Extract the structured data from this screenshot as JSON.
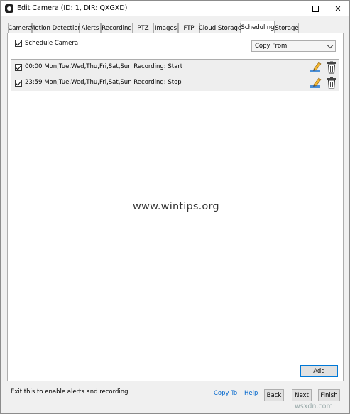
{
  "window": {
    "title": "Edit Camera (ID: 1, DIR: QXGXD)"
  },
  "tabs": [
    {
      "label": "Camera"
    },
    {
      "label": "Motion Detection"
    },
    {
      "label": "Alerts"
    },
    {
      "label": "Recording"
    },
    {
      "label": "PTZ"
    },
    {
      "label": "Images"
    },
    {
      "label": "FTP"
    },
    {
      "label": "Cloud Storage"
    },
    {
      "label": "Scheduling",
      "active": true
    },
    {
      "label": "Storage"
    }
  ],
  "scheduling": {
    "schedule_camera_label": "Schedule Camera",
    "schedule_camera_checked": true,
    "copy_from": "Copy From",
    "entries": [
      {
        "text": "00:00 Mon,Tue,Wed,Thu,Fri,Sat,Sun Recording: Start",
        "checked": true
      },
      {
        "text": "23:59 Mon,Tue,Wed,Thu,Fri,Sat,Sun Recording: Stop",
        "checked": true
      }
    ],
    "add_label": "Add"
  },
  "footer": {
    "hint": "Exit this to enable alerts and recording",
    "copy_to": "Copy To",
    "help": "Help",
    "back": "Back",
    "next": "Next",
    "finish": "Finish"
  },
  "watermark": "www.wintips.org",
  "brand": "wsxdn.com",
  "colors": {
    "link": "#0066cc",
    "default_button_border": "#0078d7",
    "row_background": "#eeeeee"
  }
}
